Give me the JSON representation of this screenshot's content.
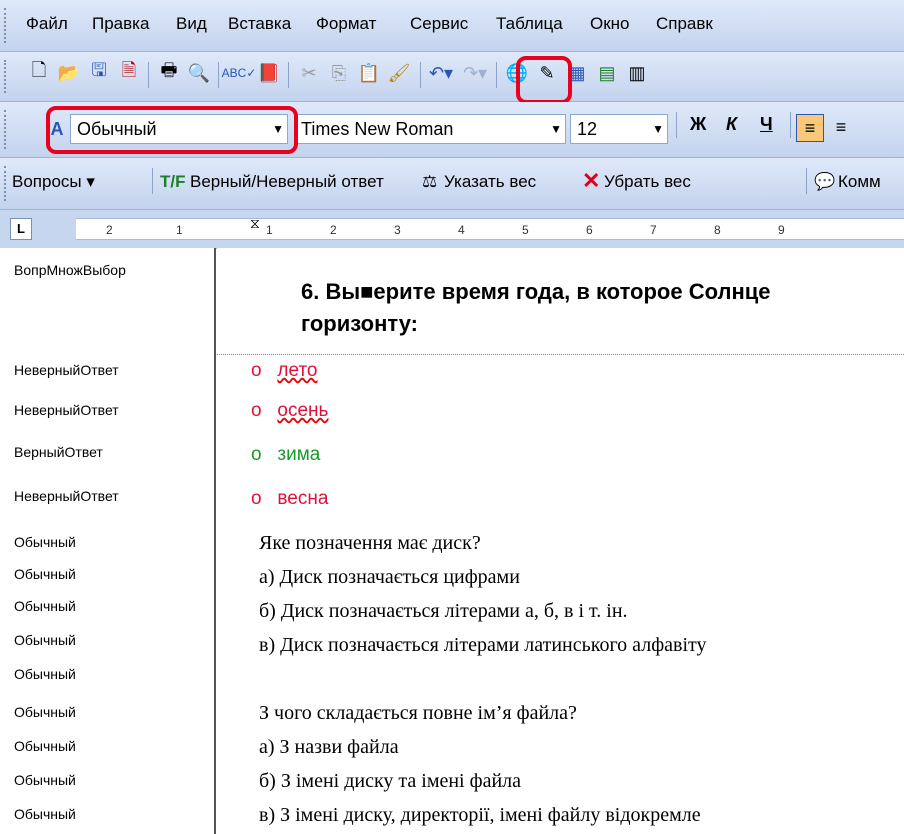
{
  "menu": [
    "Файл",
    "Правка",
    "Вид",
    "Вставка",
    "Формат",
    "Сервис",
    "Таблица",
    "Окно",
    "Справк"
  ],
  "toolbar": {
    "style_combo": "Обычный",
    "font_combo": "Times New Roman",
    "size_combo": "12",
    "bold": "Ж",
    "italic": "К",
    "underline": "Ч"
  },
  "question_toolbar": {
    "questions_menu": "Вопросы ▾",
    "correct_incorrect": "Верный/Неверный ответ",
    "set_weight": "Указать вес",
    "remove_weight": "Убрать вес",
    "comment": "Комм"
  },
  "ruler": [
    "2",
    "1",
    "1",
    "2",
    "3",
    "4",
    "5",
    "6",
    "7",
    "8",
    "9"
  ],
  "style_pane": [
    "ВопрМножВыбор",
    "НеверныйОтвет",
    "НеверныйОтвет",
    "ВерныйОтвет",
    "НеверныйОтвет",
    "Обычный",
    "Обычный",
    "Обычный",
    "Обычный",
    "Обычный",
    "Обычный",
    "Обычный",
    "Обычный",
    "Обычный"
  ],
  "document": {
    "q6_line1": "6.  Вы■ерите время года, в которое Солнце",
    "q6_line2": "горизонту:",
    "answers": [
      {
        "bullet": "о",
        "text": "лето"
      },
      {
        "bullet": "о",
        "text": "осень"
      },
      {
        "bullet": "о",
        "text": "зима"
      },
      {
        "bullet": "о",
        "text": "весна"
      }
    ],
    "lines": [
      "Яке позначення має диск?",
      "а) Диск позначається цифрами",
      "б) Диск позначається літерами а, б, в і т. ін.",
      "в) Диск позначається літерами латинського алфавіту",
      "",
      "З чого складається повне ім’я файла?",
      "а) З назви файла",
      "б) З імені диску та імені файла",
      "в) З імені диску, директорії, імені файлу відокремле"
    ]
  },
  "colors": {
    "wrong": "#e0103a",
    "correct": "#199a2c",
    "highlight": "#e8001c"
  }
}
